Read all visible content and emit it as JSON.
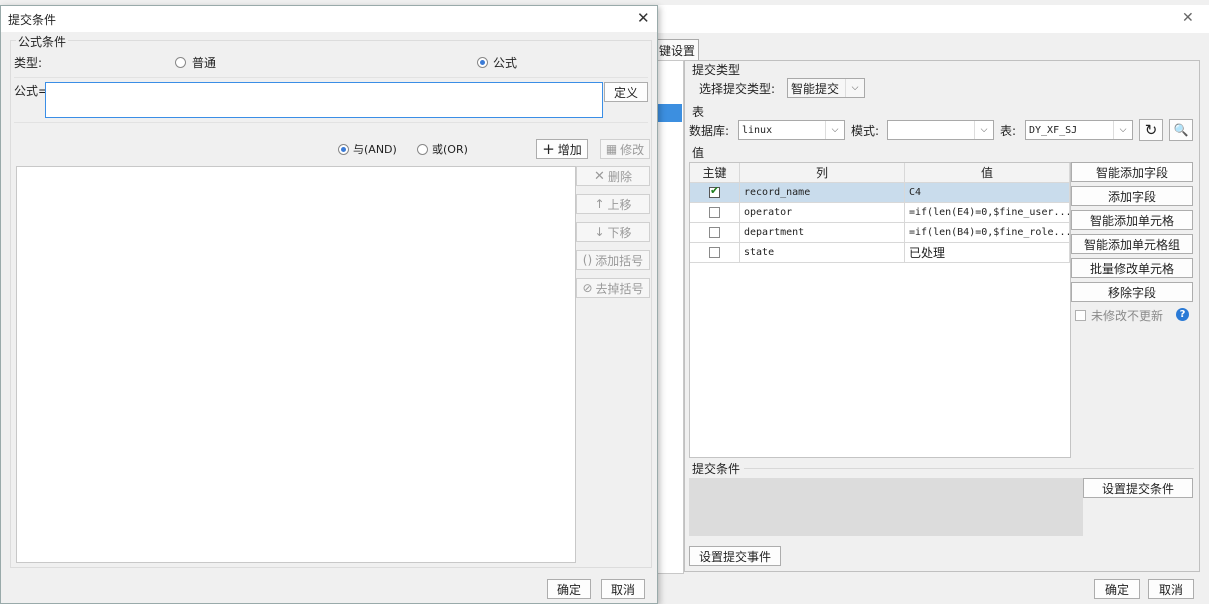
{
  "background_window": {
    "tab_label": "键设置",
    "submit_type_section": "提交类型",
    "select_submit_type_label": "选择提交类型:",
    "submit_type_value": "智能提交",
    "table_section": "表",
    "database_label": "数据库:",
    "database_value": "linux",
    "schema_label": "模式:",
    "schema_value": "",
    "table_label": "表:",
    "table_value": "DY_XF_SJ",
    "values_section": "值",
    "grid": {
      "headers": [
        "主键",
        "列",
        "值"
      ],
      "rows": [
        {
          "key": true,
          "column": "record_name",
          "value": "C4",
          "selected": true
        },
        {
          "key": false,
          "column": "operator",
          "value": "=if(len(E4)=0,$fine_user..."
        },
        {
          "key": false,
          "column": "department",
          "value": "=if(len(B4)=0,$fine_role..."
        },
        {
          "key": false,
          "column": "state",
          "value": "已处理"
        }
      ]
    },
    "side_buttons": [
      "智能添加字段",
      "添加字段",
      "智能添加单元格",
      "智能添加单元格组",
      "批量修改单元格",
      "移除字段"
    ],
    "unmodified_no_update": "未修改不更新",
    "help_icon_text": "?",
    "submit_condition_section": "提交条件",
    "set_submit_condition": "设置提交条件",
    "set_submit_event": "设置提交事件",
    "ok": "确定",
    "cancel": "取消"
  },
  "dialog": {
    "title": "提交条件",
    "close_glyph": "✕",
    "formula_condition_group": "公式条件",
    "type_label": "类型:",
    "type_options": [
      "普通",
      "公式"
    ],
    "type_selected": "公式",
    "formula_label": "公式=",
    "formula_value": "",
    "define_button": "定义",
    "logic_options": [
      "与(AND)",
      "或(OR)"
    ],
    "logic_selected": "与(AND)",
    "add_button": "增加",
    "modify_button": "修改",
    "delete_button": "删除",
    "move_up_button": "上移",
    "move_down_button": "下移",
    "add_bracket_button": "添加括号",
    "remove_bracket_button": "去掉括号",
    "ok": "确定",
    "cancel": "取消"
  }
}
